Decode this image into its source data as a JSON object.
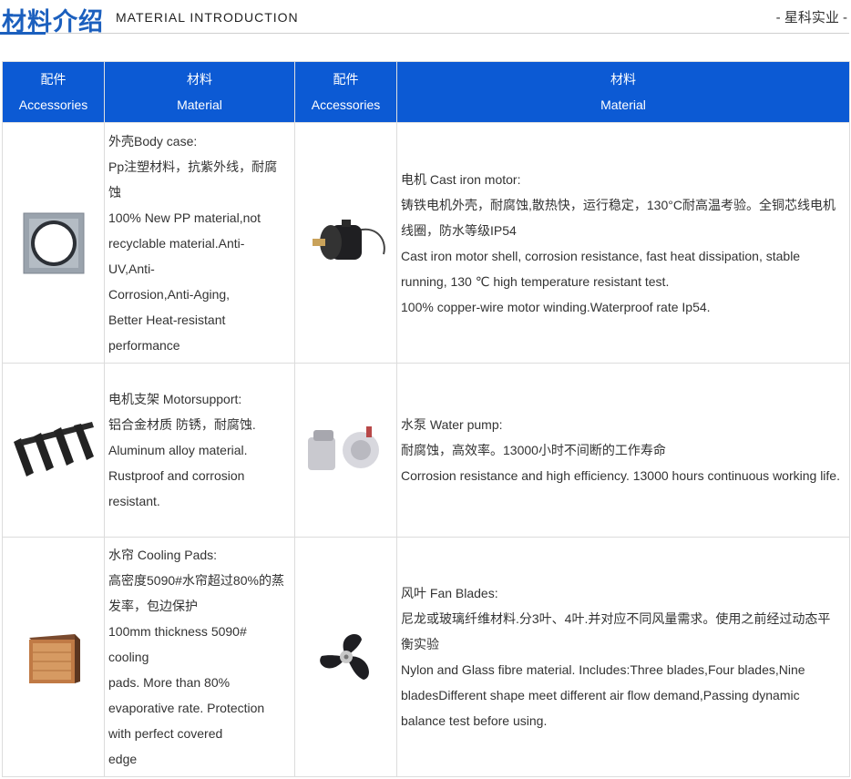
{
  "header": {
    "title_cn": "材料介绍",
    "title_en": "MATERIAL INTRODUCTION",
    "company": "- 星科实业 -"
  },
  "table": {
    "headers": [
      {
        "cn": "配件",
        "en": "Accessories"
      },
      {
        "cn": "材料",
        "en": "Material"
      },
      {
        "cn": "配件",
        "en": "Accessories"
      },
      {
        "cn": "材料",
        "en": "Material"
      }
    ],
    "rows": [
      {
        "left": {
          "icon": "body-case-image",
          "lines": [
            "外壳Body case:",
            "Pp注塑材料，抗紫外线，耐腐",
            "蚀",
            "100% New PP material,not",
            "recyclable material.Anti-",
            "UV,Anti-",
            "Corrosion,Anti-Aging,",
            "Better Heat-resistant",
            "performance"
          ]
        },
        "right": {
          "icon": "motor-image",
          "lines": [
            "电机 Cast iron motor:",
            "铸铁电机外壳，耐腐蚀,散热快，运行稳定，130°C耐高温考验。全铜芯线电机",
            "线圈，防水等级IP54",
            "Cast iron motor shell, corrosion resistance, fast heat dissipation, stable",
            "running, 130 ℃ high temperature resistant test.",
            "100% copper-wire motor winding.Waterproof rate Ip54."
          ]
        }
      },
      {
        "left": {
          "icon": "motor-support-image",
          "lines": [
            "电机支架 Motorsupport:",
            "铝合金材质 防锈，耐腐蚀.",
            "Aluminum alloy material.",
            "Rustproof and corrosion",
            "resistant."
          ]
        },
        "right": {
          "icon": "water-pump-image",
          "lines": [
            "水泵 Water pump:",
            "耐腐蚀，高效率。13000小时不间断的工作寿命",
            "Corrosion resistance and high efficiency. 13000 hours continuous working life."
          ]
        }
      },
      {
        "left": {
          "icon": "cooling-pad-image",
          "lines": [
            "水帘 Cooling Pads:",
            "高密度5090#水帘超过80%的蒸",
            "发率，包边保护",
            "100mm thickness 5090#",
            "cooling",
            "pads. More than 80%",
            "evaporative rate. Protection",
            "with perfect covered",
            "edge"
          ]
        },
        "right": {
          "icon": "fan-blade-image",
          "lines": [
            "风叶 Fan Blades:",
            "尼龙或玻璃纤维材料.分3叶、4叶.并对应不同风量需求。使用之前经过动态平",
            "衡实验",
            "Nylon and Glass fibre material. Includes:Three blades,Four blades,Nine",
            "bladesDifferent shape meet different air flow demand,Passing dynamic",
            "balance test before using."
          ]
        }
      }
    ]
  }
}
